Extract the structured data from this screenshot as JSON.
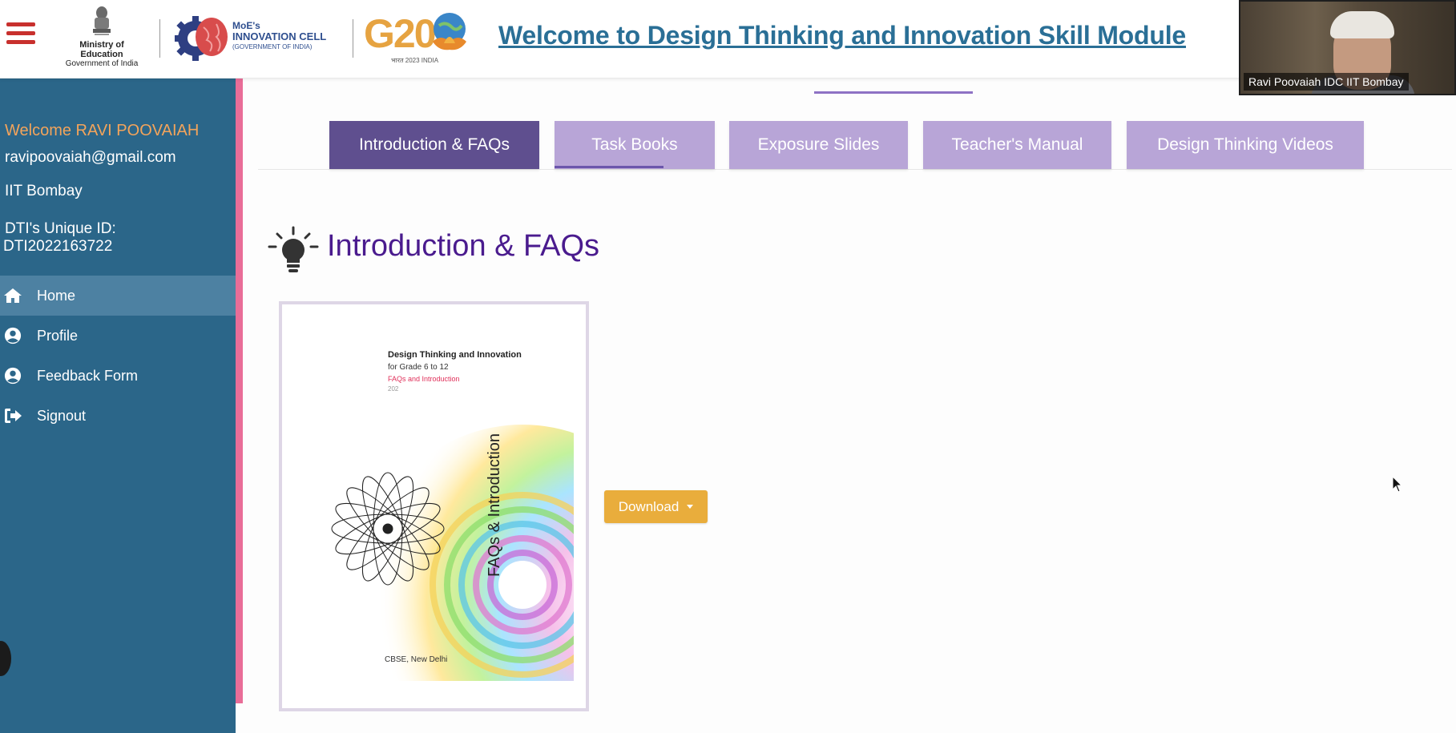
{
  "header": {
    "title": "Welcome to Design Thinking and Innovation Skill Module",
    "moe_logo": {
      "line1": "Ministry of Education",
      "line2": "Government of India"
    },
    "mic_logo": {
      "line1": "MoE's",
      "line2": "INNOVATION CELL",
      "line3": "(GOVERNMENT OF INDIA)"
    },
    "g20_logo": {
      "text": "G20",
      "sub": "भारत 2023 INDIA"
    }
  },
  "video": {
    "participant_name": "Ravi Poovaiah IDC IIT Bombay"
  },
  "sidebar": {
    "welcome": "Welcome RAVI POOVAIAH",
    "email": "ravipoovaiah@gmail.com",
    "organization": "IIT Bombay",
    "uid_label": "DTI's Unique ID:",
    "uid_value": "DTI2022163722",
    "items": [
      {
        "label": "Home",
        "icon": "home-icon",
        "active": true
      },
      {
        "label": "Profile",
        "icon": "user-circle-icon",
        "active": false
      },
      {
        "label": "Feedback Form",
        "icon": "user-circle-icon",
        "active": false
      },
      {
        "label": "Signout",
        "icon": "signout-icon",
        "active": false
      }
    ]
  },
  "tabs": [
    {
      "label": "Introduction & FAQs",
      "active": true
    },
    {
      "label": "Task Books",
      "active": false
    },
    {
      "label": "Exposure Slides",
      "active": false
    },
    {
      "label": "Teacher's Manual",
      "active": false
    },
    {
      "label": "Design Thinking Videos",
      "active": false
    }
  ],
  "section": {
    "title": "Introduction & FAQs",
    "icon": "lightbulb-icon"
  },
  "book": {
    "title": "Design Thinking and Innovation",
    "grade": "for Grade 6 to 12",
    "subtitle": "FAQs and Introduction",
    "year": "202",
    "spine_text": "FAQs & Introduction",
    "publisher": "CBSE, New Delhi"
  },
  "download": {
    "label": "Download"
  },
  "colors": {
    "sidebar_bg": "#2b6689",
    "sidebar_accent": "#e96d98",
    "tab_active": "#5f4f8f",
    "tab_inactive": "#b8a5d7",
    "title_purple": "#4a1b8e",
    "download_bg": "#e9ad3c",
    "header_title": "#2a6f96"
  }
}
